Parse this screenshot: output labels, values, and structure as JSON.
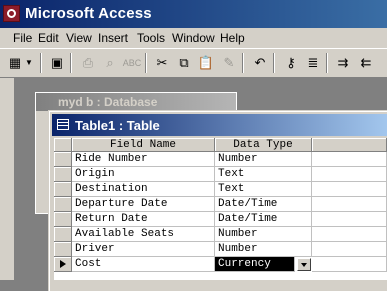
{
  "window": {
    "title": "Microsoft Access"
  },
  "menu": [
    "File",
    "Edit",
    "View",
    "Insert",
    "Tools",
    "Window",
    "Help"
  ],
  "toolbar": {
    "icons": [
      "view-icon",
      "save-icon",
      "print-icon",
      "print-preview-icon",
      "spelling-icon",
      "cut-icon",
      "copy-icon",
      "paste-icon",
      "format-painter-icon",
      "undo-icon",
      "primary-key-icon",
      "indexes-icon",
      "insert-rows-icon",
      "delete-rows-icon"
    ]
  },
  "db_window": {
    "title": "myd b : Database"
  },
  "table_window": {
    "title": "Table1 : Table"
  },
  "grid": {
    "headers": [
      "Field Name",
      "Data Type"
    ],
    "rows": [
      {
        "field": "Ride Number",
        "type": "Number"
      },
      {
        "field": "Origin",
        "type": "Text"
      },
      {
        "field": "Destination",
        "type": "Text"
      },
      {
        "field": "Departure Date",
        "type": "Date/Time"
      },
      {
        "field": "Return Date",
        "type": "Date/Time"
      },
      {
        "field": "Available Seats",
        "type": "Number"
      },
      {
        "field": "Driver",
        "type": "Number"
      },
      {
        "field": "Cost",
        "type": "Currency"
      }
    ],
    "current_row": 7
  }
}
